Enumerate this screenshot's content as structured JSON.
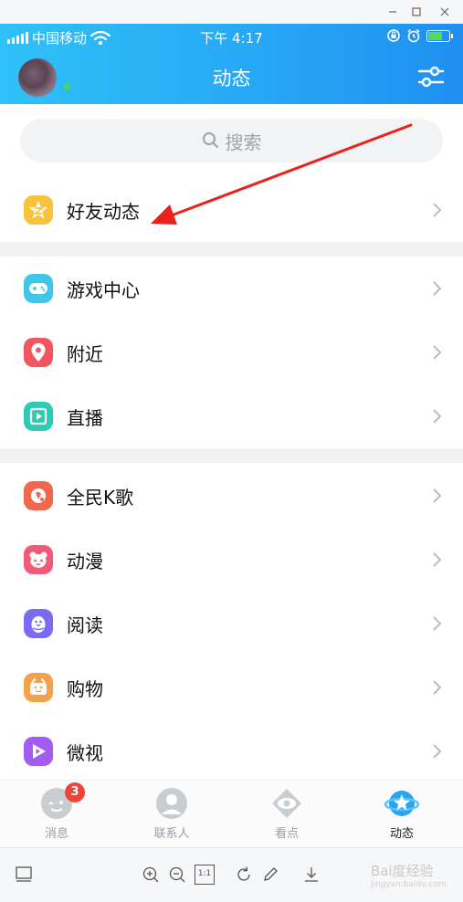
{
  "status_bar": {
    "carrier": "中国移动",
    "time": "下午 4:17",
    "battery_level": 0.7
  },
  "header": {
    "title": "动态",
    "settings_icon": "sliders-icon"
  },
  "search": {
    "placeholder": "搜索",
    "icon": "search-icon"
  },
  "groups": [
    {
      "items": [
        {
          "label": "好友动态",
          "icon": "qzone-star-icon",
          "color": "#f7c23c"
        }
      ]
    },
    {
      "items": [
        {
          "label": "游戏中心",
          "icon": "gamepad-icon",
          "color": "#3fc6e8"
        },
        {
          "label": "附近",
          "icon": "location-pin-icon",
          "color": "#f2565f"
        },
        {
          "label": "直播",
          "icon": "live-play-icon",
          "color": "#2ccbb4"
        }
      ]
    },
    {
      "items": [
        {
          "label": "全民K歌",
          "icon": "karaoke-icon",
          "color": "#f2684f"
        },
        {
          "label": "动漫",
          "icon": "anime-face-icon",
          "color": "#f25a7a"
        },
        {
          "label": "阅读",
          "icon": "reading-penguin-icon",
          "color": "#7a6cf0"
        },
        {
          "label": "购物",
          "icon": "shopping-bag-icon",
          "color": "#f5a14a"
        },
        {
          "label": "微视",
          "icon": "video-play-icon",
          "color": "#a35cf0"
        }
      ]
    }
  ],
  "tabs": [
    {
      "label": "消息",
      "icon": "message-bubble-icon",
      "badge": "3",
      "active": false
    },
    {
      "label": "联系人",
      "icon": "contacts-icon",
      "badge": "",
      "active": false
    },
    {
      "label": "看点",
      "icon": "eye-icon",
      "badge": "",
      "active": false
    },
    {
      "label": "动态",
      "icon": "planet-star-icon",
      "badge": "",
      "active": true
    }
  ],
  "viewer_toolbar": {
    "icons": [
      "thumbnail-icon",
      "zoom-in-icon",
      "zoom-out-icon",
      "actual-size-icon",
      "rotate-icon",
      "edit-icon",
      "download-icon"
    ],
    "actual_size_label": "1:1"
  },
  "watermark": {
    "brand": "Bai度经验",
    "url": "jingyan.baidu.com"
  },
  "colors": {
    "header_start": "#2fc1f8",
    "header_end": "#1f8ff0",
    "annotation_arrow": "#e8231e",
    "badge": "#f0443a"
  }
}
